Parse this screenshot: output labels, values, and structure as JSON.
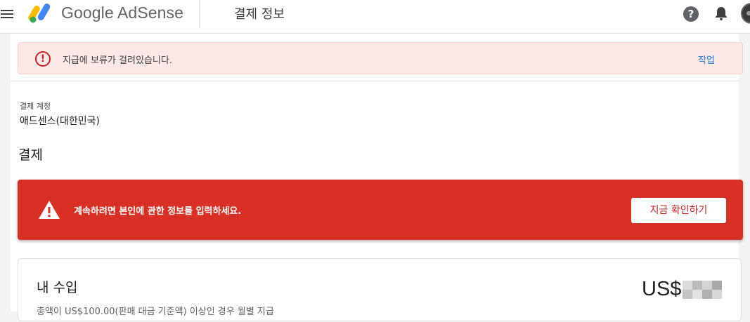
{
  "app": {
    "brand": "Google AdSense",
    "page_title": "결제 정보"
  },
  "hold_banner": {
    "message": "지급에 보류가 걸려있습니다.",
    "action": "작업"
  },
  "account": {
    "label": "결제 계정",
    "value": "애드센스(대한민국)"
  },
  "section_title": "결제",
  "alert": {
    "message": "계속하려면 본인에 관한 정보를 입력하세요.",
    "button": "지금 확인하기"
  },
  "earnings": {
    "title": "내 수입",
    "amount_prefix": "US$",
    "subtitle": "총액이 US$100.00(판매 대금 기준액) 이상인 경우 월별 지급"
  },
  "icons": {
    "menu": "menu-icon",
    "help": "help-icon",
    "notifications": "bell-icon",
    "hold": "error-circle-icon",
    "alert": "warning-triangle-icon"
  },
  "colors": {
    "alert_red": "#d93025",
    "hold_bg": "#fce8e6",
    "link_blue": "#1a73e8"
  }
}
